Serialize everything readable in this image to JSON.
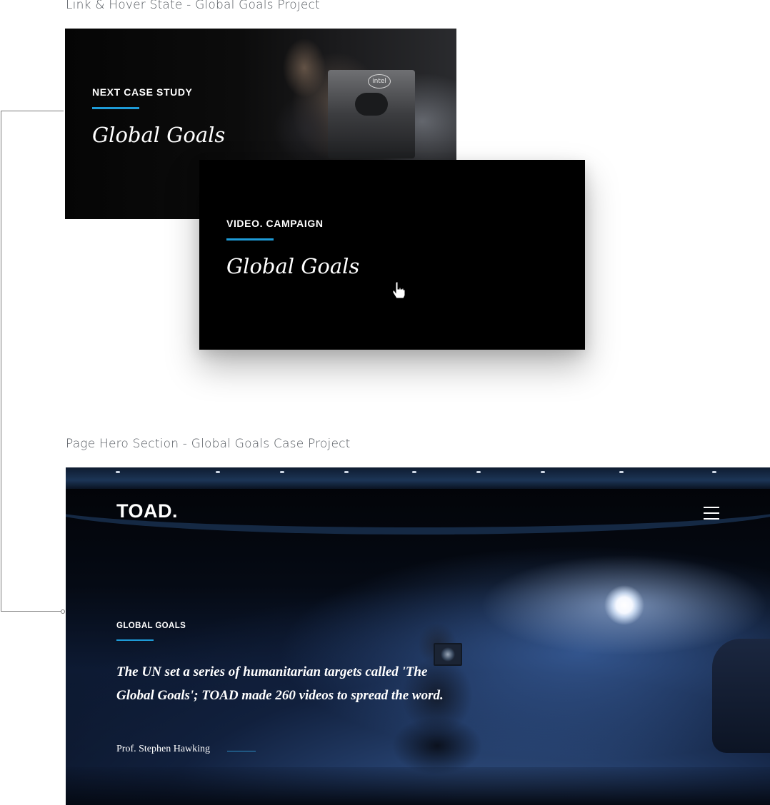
{
  "labels": {
    "link_hover": "Link & Hover State - Global Goals Project",
    "page_hero": "Page Hero Section - Global Goals Case Project"
  },
  "next_card": {
    "eyebrow": "NEXT CASE STUDY",
    "title": "Global Goals",
    "device_logo": "intel"
  },
  "hover_card": {
    "eyebrow": "VIDEO. CAMPAIGN",
    "title": "Global Goals"
  },
  "hero": {
    "logo": "TOAD.",
    "eyebrow": "GLOBAL GOALS",
    "quote": "The UN set a series of humanitarian targets called 'The Global Goals'; TOAD made 260 videos to spread the word.",
    "author": "Prof. Stephen Hawking",
    "menu_icon": "hamburger-menu-icon"
  },
  "colors": {
    "accent": "#1e9bd7",
    "card_bg": "#000000",
    "label_text": "#555a60"
  }
}
